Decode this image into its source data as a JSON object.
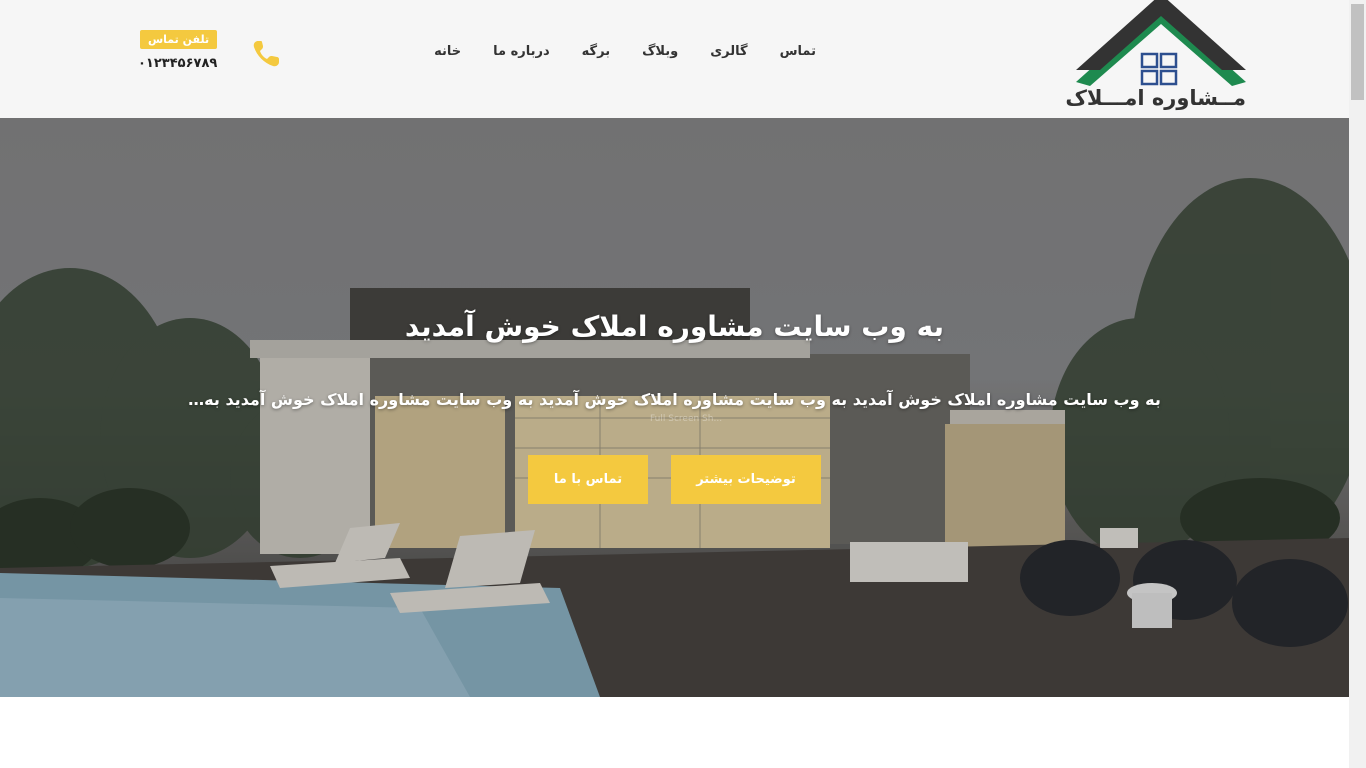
{
  "brand": {
    "logo_text": "مــشاوره امـــلاک",
    "colors": {
      "roof": "#333333",
      "green": "#1e8a4f",
      "window": "#2d4f8f"
    }
  },
  "nav": {
    "items": [
      {
        "label": "خانه"
      },
      {
        "label": "درباره ما"
      },
      {
        "label": "برگه"
      },
      {
        "label": "وبلاگ"
      },
      {
        "label": "گالری"
      },
      {
        "label": "تماس"
      }
    ]
  },
  "contact": {
    "badge": "تلفن تماس",
    "phone": "۰۱۲۳۴۵۶۷۸۹",
    "icon": "phone-icon"
  },
  "hero": {
    "title": "به وب  سایت  مشاوره املاک خوش آمدید",
    "subtitle": "به وب سایت مشاوره املاک خوش آمدید به وب سایت مشاوره املاک خوش آمدید به وب سایت مشاوره املاک خوش آمدید به…",
    "watermark": "Full Screen Sh...",
    "buttons": {
      "more": "توضیحات بیشتر",
      "contact": "تماس با ما"
    }
  },
  "colors": {
    "accent": "#f4c93f",
    "header_bg": "#f6f6f6",
    "text": "#333333"
  }
}
